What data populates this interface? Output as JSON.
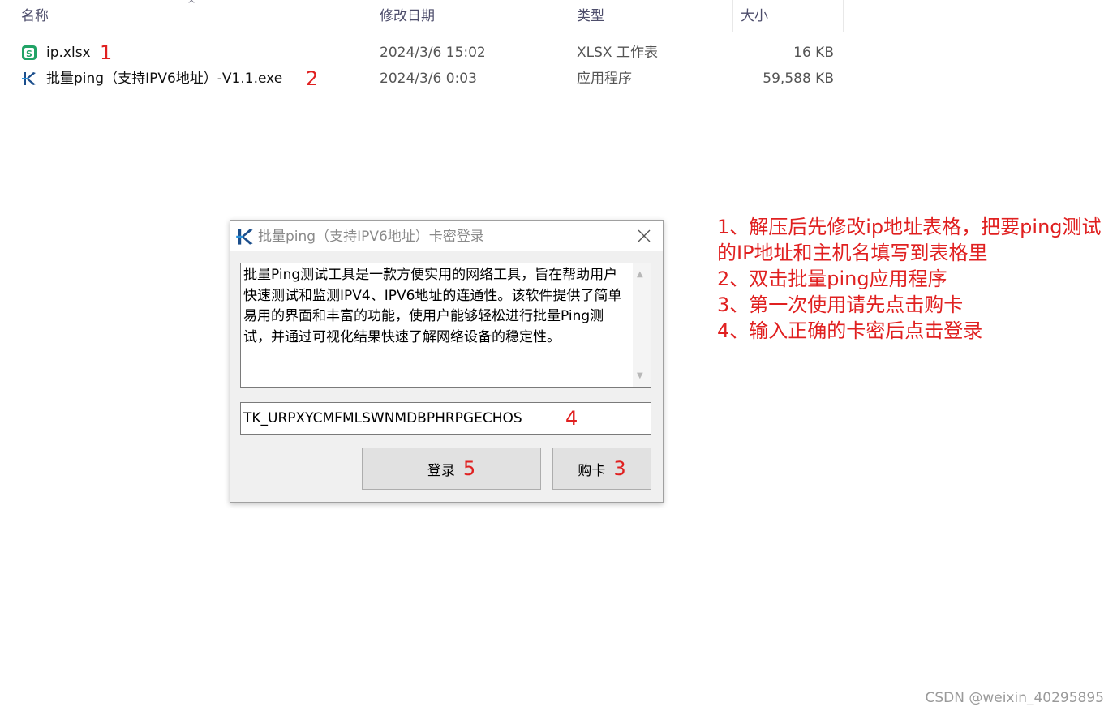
{
  "explorer": {
    "columns": [
      "名称",
      "修改日期",
      "类型",
      "大小"
    ],
    "sort_caret": "^",
    "files": [
      {
        "name": "ip.xlsx",
        "date": "2024/3/6 15:02",
        "type": "XLSX 工作表",
        "size": "16 KB",
        "step": "1",
        "icon": "spreadsheet-icon"
      },
      {
        "name": "批量ping（支持IPV6地址）-V1.1.exe",
        "date": "2024/3/6 0:03",
        "type": "应用程序",
        "size": "59,588 KB",
        "step": "2",
        "icon": "app-icon"
      }
    ]
  },
  "dialog": {
    "title": "批量ping（支持IPV6地址）卡密登录",
    "description": "批量Ping测试工具是一款方便实用的网络工具，旨在帮助用户快速测试和监测IPV4、IPV6地址的连通性。该软件提供了简单易用的界面和丰富的功能，使用户能够轻松进行批量Ping测试，并通过可视化结果快速了解网络设备的稳定性。",
    "key_value": "TK_URPXYCMFMLSWNMDBPHRPGECHOS",
    "key_step": "4",
    "login_label": "登录",
    "login_step": "5",
    "buy_label": "购卡",
    "buy_step": "3"
  },
  "instructions": [
    "1、解压后先修改ip地址表格，把要ping测试的IP地址和主机名填写到表格里",
    "2、双击批量ping应用程序",
    "3、第一次使用请先点击购卡",
    "4、输入正确的卡密后点击登录"
  ],
  "watermark": "CSDN @weixin_40295895",
  "colors": {
    "annotation": "#e02020",
    "spreadsheet_green": "#21a366",
    "app_icon_blue": "#1b4e8c"
  }
}
